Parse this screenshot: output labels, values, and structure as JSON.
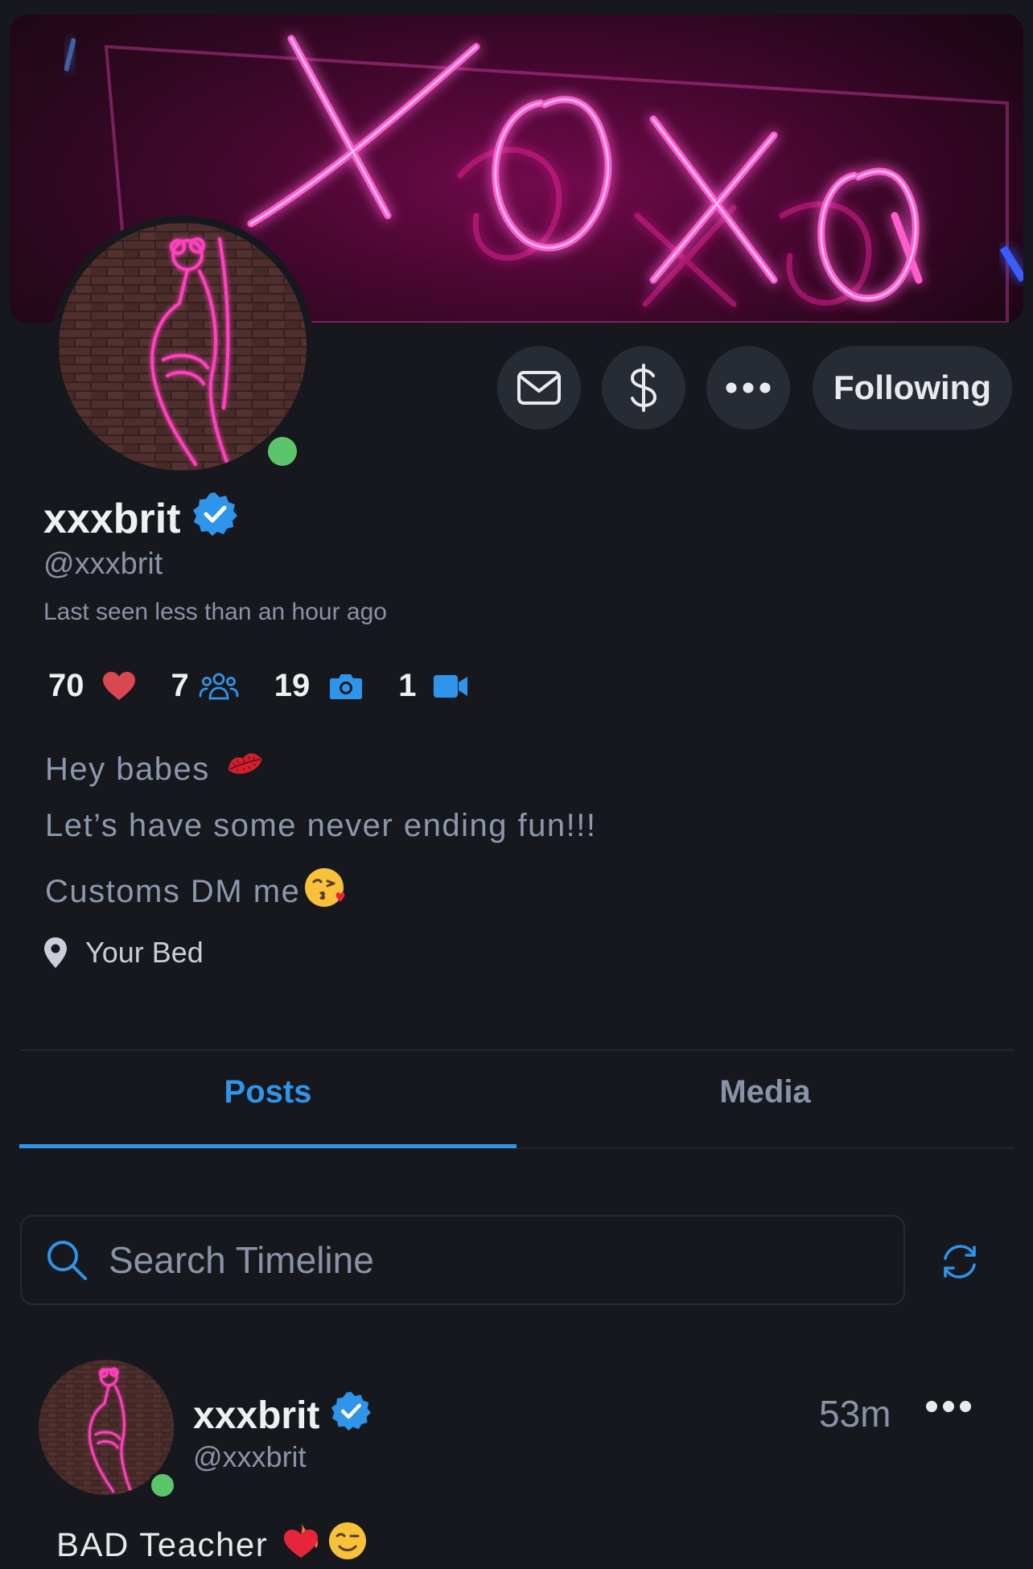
{
  "banner": {
    "neon_text": "XOXO",
    "neon_color": "#ff3fbf"
  },
  "profile": {
    "display_name": "xxxbrit",
    "handle": "@xxxbrit",
    "last_seen": "Last seen less than an hour ago",
    "verified_icon": "verified-badge-icon",
    "online_color": "#5cc46a"
  },
  "actions": {
    "message_icon": "envelope-icon",
    "tip_icon": "dollar-icon",
    "more_icon": "more-dots-icon",
    "follow_label": "Following"
  },
  "stats": [
    {
      "value": "70",
      "icon": "heart-icon"
    },
    {
      "value": "7",
      "icon": "users-icon"
    },
    {
      "value": "19",
      "icon": "camera-icon"
    },
    {
      "value": "1",
      "icon": "video-icon"
    }
  ],
  "bio": {
    "line1": "Hey babes",
    "line2": "Let’s have some never ending fun!!!",
    "line3": "Customs DM me"
  },
  "location": "Your Bed",
  "tabs": {
    "posts": "Posts",
    "media": "Media"
  },
  "search": {
    "placeholder": "Search Timeline"
  },
  "post": {
    "display_name": "xxxbrit",
    "handle": "@xxxbrit",
    "time": "53m",
    "text": "BAD Teacher"
  },
  "colors": {
    "accent": "#2f95ea",
    "background": "#16181d",
    "button_bg": "#272b34",
    "heart": "#d9484f"
  }
}
